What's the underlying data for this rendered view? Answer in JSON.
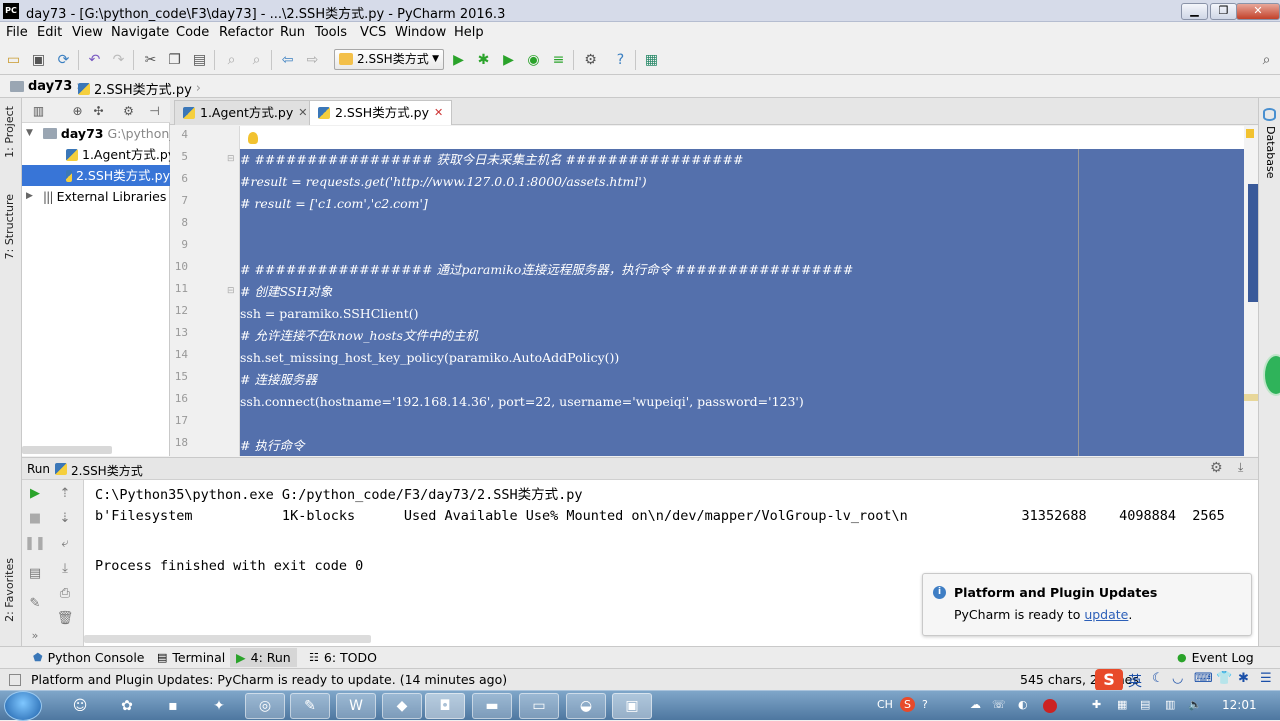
{
  "window": {
    "logo": "PC",
    "title": "day73 - [G:\\python_code\\F3\\day73] - ...\\2.SSH类方式.py - PyCharm 2016.3",
    "min": "▁",
    "max": "❐",
    "close": "✕"
  },
  "menu": [
    "File",
    "Edit",
    "View",
    "Navigate",
    "Code",
    "Refactor",
    "Run",
    "Tools",
    "VCS",
    "Window",
    "Help"
  ],
  "toolbar": {
    "run_config": "2.SSH类方式",
    "icons": [
      "open-folder-icon",
      "save-icon",
      "sync-icon",
      "undo-icon",
      "redo-icon",
      "cut-icon",
      "copy-icon",
      "paste-icon",
      "find-icon",
      "replace-icon",
      "back-icon",
      "forward-icon",
      "run-icon",
      "debug-icon",
      "coverage-icon",
      "profile-icon",
      "concurrency-icon",
      "settings-icon",
      "help-icon",
      "sdk-icon"
    ]
  },
  "breadcrumb": [
    "day73",
    "2.SSH类方式.py"
  ],
  "left_strip": {
    "project": "1: Project",
    "structure": "7: Structure",
    "favorites": "2: Favorites"
  },
  "right_strip": {
    "database": "Database"
  },
  "project_tree": [
    {
      "label": "day73",
      "extra": "G:\\python_",
      "type": "folder",
      "level": 0
    },
    {
      "label": "1.Agent方式.py",
      "type": "py",
      "level": 1
    },
    {
      "label": "2.SSH类方式.py",
      "type": "py",
      "level": 1,
      "selected": true
    },
    {
      "label": "External Libraries",
      "type": "lib",
      "level": 0
    }
  ],
  "editor_tabs": [
    {
      "label": "1.Agent方式.py"
    },
    {
      "label": "2.SSH类方式.py",
      "active": true
    }
  ],
  "code_lines": [
    {
      "n": "4",
      "text": ""
    },
    {
      "n": "5",
      "text": "# ################# 获取今日未采集主机名 #################"
    },
    {
      "n": "6",
      "text": "#result = requests.get('http://www.127.0.0.1:8000/assets.html')"
    },
    {
      "n": "7",
      "text": "# result = ['c1.com','c2.com']"
    },
    {
      "n": "8",
      "text": ""
    },
    {
      "n": "9",
      "text": ""
    },
    {
      "n": "10",
      "text": "# ################# 通过paramiko连接远程服务器，执行命令 #################"
    },
    {
      "n": "11",
      "text": "# 创建SSH对象"
    },
    {
      "n": "12",
      "text": "ssh = paramiko.SSHClient()"
    },
    {
      "n": "13",
      "text": "# 允许连接不在know_hosts文件中的主机"
    },
    {
      "n": "14",
      "text": "ssh.set_missing_host_key_policy(paramiko.AutoAddPolicy())"
    },
    {
      "n": "15",
      "text": "# 连接服务器"
    },
    {
      "n": "16",
      "text": "ssh.connect(hostname='192.168.14.36', port=22, username='wupeiqi', password='123')"
    },
    {
      "n": "17",
      "text": ""
    },
    {
      "n": "18",
      "text": "# 执行命令"
    }
  ],
  "run_panel": {
    "label": "Run",
    "config": "2.SSH类方式",
    "console": [
      "C:\\Python35\\python.exe G:/python_code/F3/day73/2.SSH类方式.py",
      "b'Filesystem           1K-blocks      Used Available Use% Mounted on\\n/dev/mapper/VolGroup-lv_root\\n              31352688    4098884  2565",
      "",
      "Process finished with exit code 0"
    ]
  },
  "notification": {
    "title": "Platform and Plugin Updates",
    "body": "PyCharm is ready to ",
    "link": "update",
    "end": "."
  },
  "bottom_tabs": [
    {
      "label": "Python Console"
    },
    {
      "label": "Terminal"
    },
    {
      "label": "4: Run",
      "active": true
    },
    {
      "label": "6: TODO"
    }
  ],
  "event_log": "Event Log",
  "status": {
    "message": "Platform and Plugin Updates: PyCharm is ready to update. (14 minutes ago)",
    "info": "545 chars, 24 lines"
  },
  "taskbar": {
    "clock": "12:01",
    "ime": "英",
    "lang": "CH"
  }
}
